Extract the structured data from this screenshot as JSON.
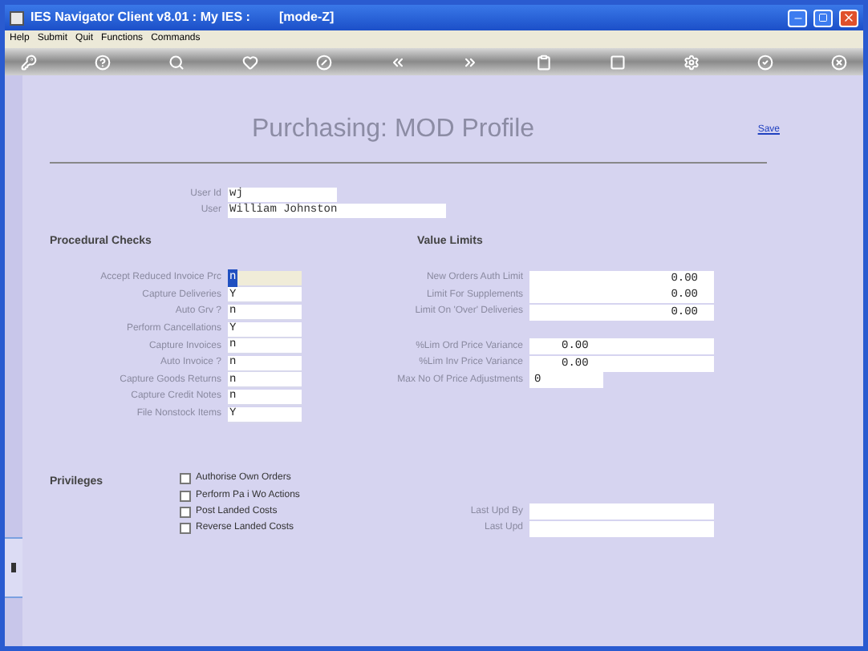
{
  "window": {
    "title": "IES Navigator Client v8.01 : My IES :",
    "mode": "[mode-Z]"
  },
  "menu": [
    "Help",
    "Submit",
    "Quit",
    "Functions",
    "Commands"
  ],
  "toolbar": [
    {
      "kind": "key"
    },
    {
      "kind": "help"
    },
    {
      "kind": "search"
    },
    {
      "kind": "heart"
    },
    {
      "kind": "slash"
    },
    {
      "kind": "back"
    },
    {
      "kind": "forward"
    },
    {
      "kind": "clip"
    },
    {
      "kind": "square"
    },
    {
      "kind": "gear"
    },
    {
      "kind": "check"
    },
    {
      "kind": "close"
    }
  ],
  "page": {
    "title": "Purchasing: MOD Profile",
    "save_link": "Save"
  },
  "user_fields": [
    {
      "label": "User Id",
      "value": "wj",
      "kind": "short"
    },
    {
      "label": "User",
      "value": "William Johnston",
      "kind": "long"
    }
  ],
  "procedural_checks": {
    "heading": "Procedural Checks",
    "rows": [
      {
        "label": "Accept Reduced Invoice Prc",
        "value": "n",
        "focused": true
      },
      {
        "label": "Capture Deliveries",
        "value": "Y",
        "focused": false
      },
      {
        "label": "Auto Grv ?",
        "value": "n",
        "focused": false
      },
      {
        "label": "Perform Cancellations",
        "value": "Y",
        "focused": false
      },
      {
        "label": "Capture Invoices",
        "value": "n",
        "focused": false
      },
      {
        "label": "Auto Invoice ?",
        "value": "n",
        "focused": false
      },
      {
        "label": "Capture Goods Returns",
        "value": "n",
        "focused": false
      },
      {
        "label": "Capture Credit Notes",
        "value": "n",
        "focused": false
      },
      {
        "label": "File Nonstock Items",
        "value": "Y",
        "focused": false
      }
    ]
  },
  "value_limits": {
    "heading": "Value Limits",
    "groups": [
      {
        "rows": [
          {
            "label": "New Orders Auth Limit",
            "value": "0.00",
            "kind": "amount"
          },
          {
            "label": "Limit For Supplements",
            "value": "0.00",
            "kind": "amount"
          },
          {
            "label": "Limit On 'Over' Deliveries",
            "value": "0.00",
            "kind": "amount"
          }
        ]
      },
      {
        "rows": [
          {
            "label": "%Lim Ord Price Variance",
            "value": "0.00",
            "kind": "percent"
          },
          {
            "label": "%Lim Inv Price Variance",
            "value": "0.00",
            "kind": "percent"
          },
          {
            "label": "Max No Of Price Adjustments",
            "value": "0",
            "kind": "count"
          }
        ]
      }
    ]
  },
  "privileges": {
    "heading": "Privileges",
    "items": [
      {
        "label": "Authorise Own Orders",
        "checked": false
      },
      {
        "label": "Perform Pa i Wo Actions",
        "checked": false
      },
      {
        "label": "Post Landed Costs",
        "checked": false
      },
      {
        "label": "Reverse Landed Costs",
        "checked": false
      }
    ]
  },
  "audit_fields": [
    {
      "label": "Last Upd By"
    },
    {
      "label": "Last Upd"
    }
  ]
}
